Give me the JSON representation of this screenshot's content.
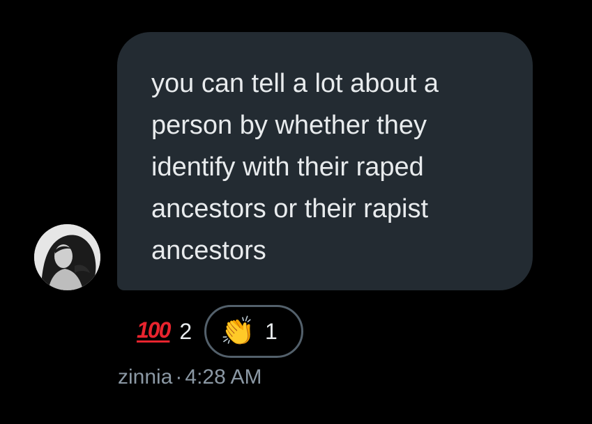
{
  "message": {
    "text": "you can tell a lot about a person by whether they identify with their raped ancestors or their rapist ancestors"
  },
  "reactions": [
    {
      "emoji_name": "hundred-points",
      "glyph": "100",
      "count": "2",
      "selected": false
    },
    {
      "emoji_name": "clapping-hands",
      "glyph": "👏",
      "count": "1",
      "selected": true
    }
  ],
  "meta": {
    "sender": "zinnia",
    "separator": "·",
    "time": "4:28 AM"
  },
  "colors": {
    "background": "#000000",
    "bubble": "#232b32",
    "text": "#e8ebed",
    "meta_text": "#8b98a4",
    "reaction_outline": "#53606b",
    "hundred_red": "#e8242e"
  }
}
